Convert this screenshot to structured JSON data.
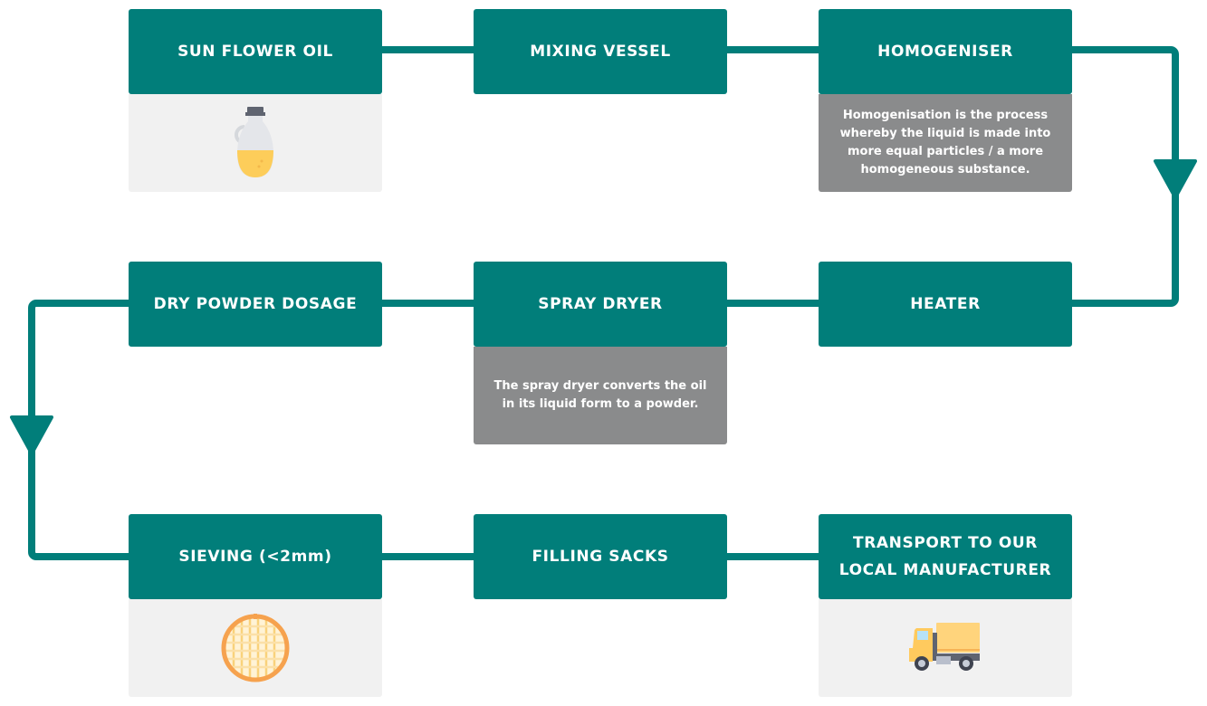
{
  "diagram": {
    "type": "process-flow",
    "colors": {
      "step_header": "#017e7a",
      "connector": "#017e7a",
      "info_panel": "#8a8b8c",
      "image_panel": "#f1f1f1",
      "text": "#ffffff"
    },
    "steps": [
      {
        "label": "SUN FLOWER OIL",
        "panel": "image",
        "icon": "oil-bottle-icon"
      },
      {
        "label": "MIXING VESSEL",
        "panel": "none"
      },
      {
        "label": "HOMOGENISER",
        "panel": "info",
        "description": "Homogenisation is the process whereby the liquid is made into more equal particles / a more homogeneous substance."
      },
      {
        "label": "HEATER",
        "panel": "none"
      },
      {
        "label": "SPRAY DRYER",
        "panel": "info",
        "description": "The spray dryer converts the oil in its liquid form to a powder."
      },
      {
        "label": "DRY POWDER DOSAGE",
        "panel": "none"
      },
      {
        "label": "SIEVING (<2mm)",
        "panel": "image",
        "icon": "sieve-icon"
      },
      {
        "label": "FILLING SACKS",
        "panel": "none"
      },
      {
        "label": "TRANSPORT TO OUR LOCAL MANUFACTURER",
        "panel": "image",
        "icon": "truck-icon"
      }
    ],
    "flow": [
      "SUN FLOWER OIL",
      "MIXING VESSEL",
      "HOMOGENISER",
      "HEATER",
      "SPRAY DRYER",
      "DRY POWDER DOSAGE",
      "SIEVING (<2mm)",
      "FILLING SACKS",
      "TRANSPORT TO OUR LOCAL MANUFACTURER"
    ]
  }
}
